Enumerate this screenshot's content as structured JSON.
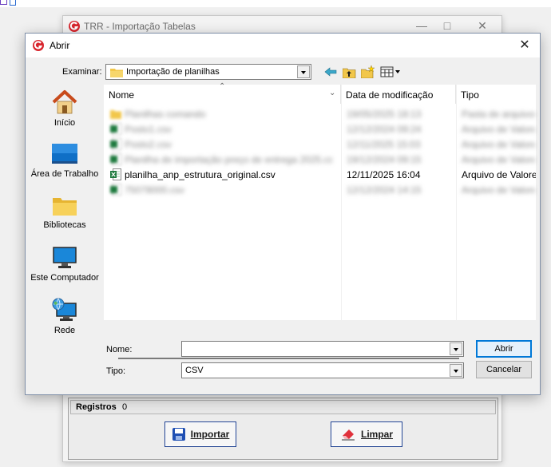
{
  "background_window": {
    "title": "TRR - Importação Tabelas",
    "registros_label": "Registros",
    "registros_value": "0",
    "importar_label": "Importar",
    "limpar_label": "Limpar"
  },
  "dialog": {
    "title": "Abrir",
    "examinar_label": "Examinar:",
    "current_folder": "Importação de planilhas",
    "places": [
      {
        "label": "Início",
        "icon": "home-icon"
      },
      {
        "label": "Área de Trabalho",
        "icon": "desktop-icon"
      },
      {
        "label": "Bibliotecas",
        "icon": "libraries-icon"
      },
      {
        "label": "Este Computador",
        "icon": "computer-icon"
      },
      {
        "label": "Rede",
        "icon": "network-icon"
      }
    ],
    "columns": {
      "name": "Nome",
      "date": "Data de modificação",
      "type": "Tipo"
    },
    "files": [
      {
        "name": "Planilhas comando",
        "date": "19/05/2025 18:13",
        "type": "Pasta de arquivos",
        "kind": "folder",
        "blurred": true
      },
      {
        "name": "Posto1.csv",
        "date": "12/12/2024 09:24",
        "type": "Arquivo de Valores",
        "kind": "csv",
        "blurred": true
      },
      {
        "name": "Posto2.csv",
        "date": "12/11/2025 15:03",
        "type": "Arquivo de Valores",
        "kind": "csv",
        "blurred": true
      },
      {
        "name": "Planilha de importação preço de entrega 2025.csv",
        "date": "19/12/2024 09:15",
        "type": "Arquivo de Valores",
        "kind": "csv",
        "blurred": true
      },
      {
        "name": "planilha_anp_estrutura_original.csv",
        "date": "12/11/2025 16:04",
        "type": "Arquivo de Valore",
        "kind": "csv",
        "blurred": false
      },
      {
        "name": "75078000.csv",
        "date": "12/12/2024 14:15",
        "type": "Arquivo de Valores",
        "kind": "csv",
        "blurred": true
      }
    ],
    "nome_label": "Nome:",
    "nome_value": "",
    "tipo_label": "Tipo:",
    "tipo_value": "CSV",
    "abrir_button": "Abrir",
    "cancelar_button": "Cancelar"
  },
  "colors": {
    "folder": "#f2c74a",
    "excel_green": "#1e7a3e",
    "accent": "#0078d7",
    "logo_red": "#d8262e"
  }
}
